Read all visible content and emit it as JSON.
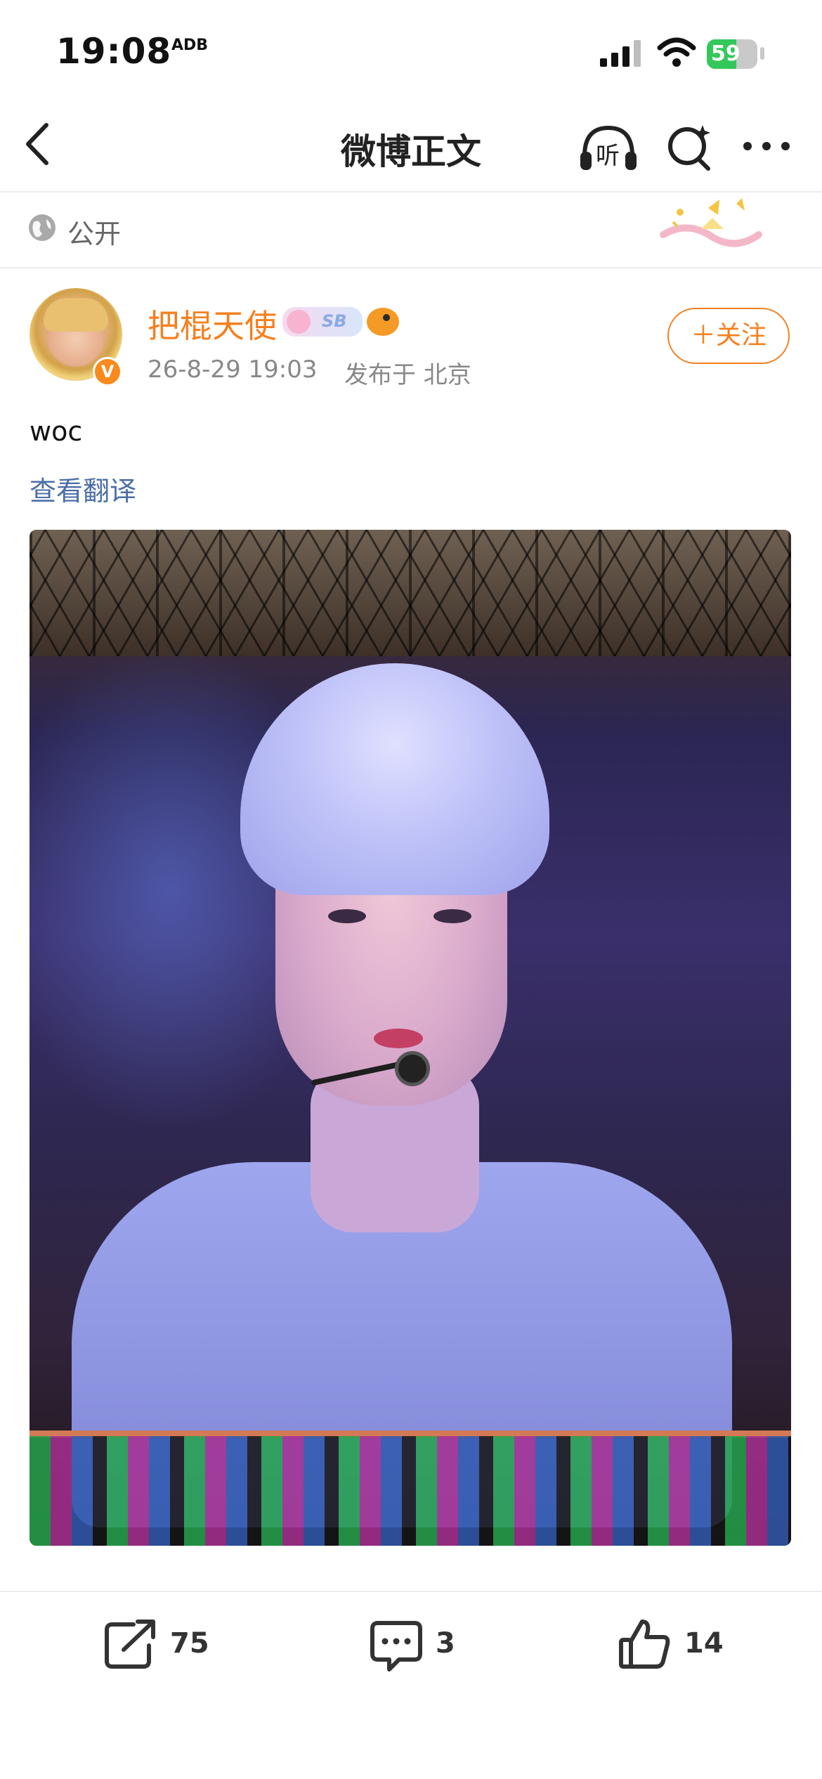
{
  "status_bar": {
    "time": "19:08",
    "app_badge": "ADB",
    "battery": 59,
    "battery_color": "#34c759"
  },
  "nav": {
    "title": "微博正文",
    "listen_label": "听"
  },
  "visibility": {
    "label": "公开"
  },
  "author": {
    "name": "把棍天使",
    "level_badge": "SB",
    "time": "26-8-29 19:03",
    "location": "发布于 北京",
    "verified_mark": "V",
    "follow_label": "＋关注"
  },
  "post": {
    "text": "woc",
    "translate_label": "查看翻译"
  },
  "actions": {
    "share_count": "75",
    "comment_count": "3",
    "like_count": "14"
  },
  "colors": {
    "accent_orange": "#f5801f",
    "link_blue": "#4b6ea8"
  }
}
